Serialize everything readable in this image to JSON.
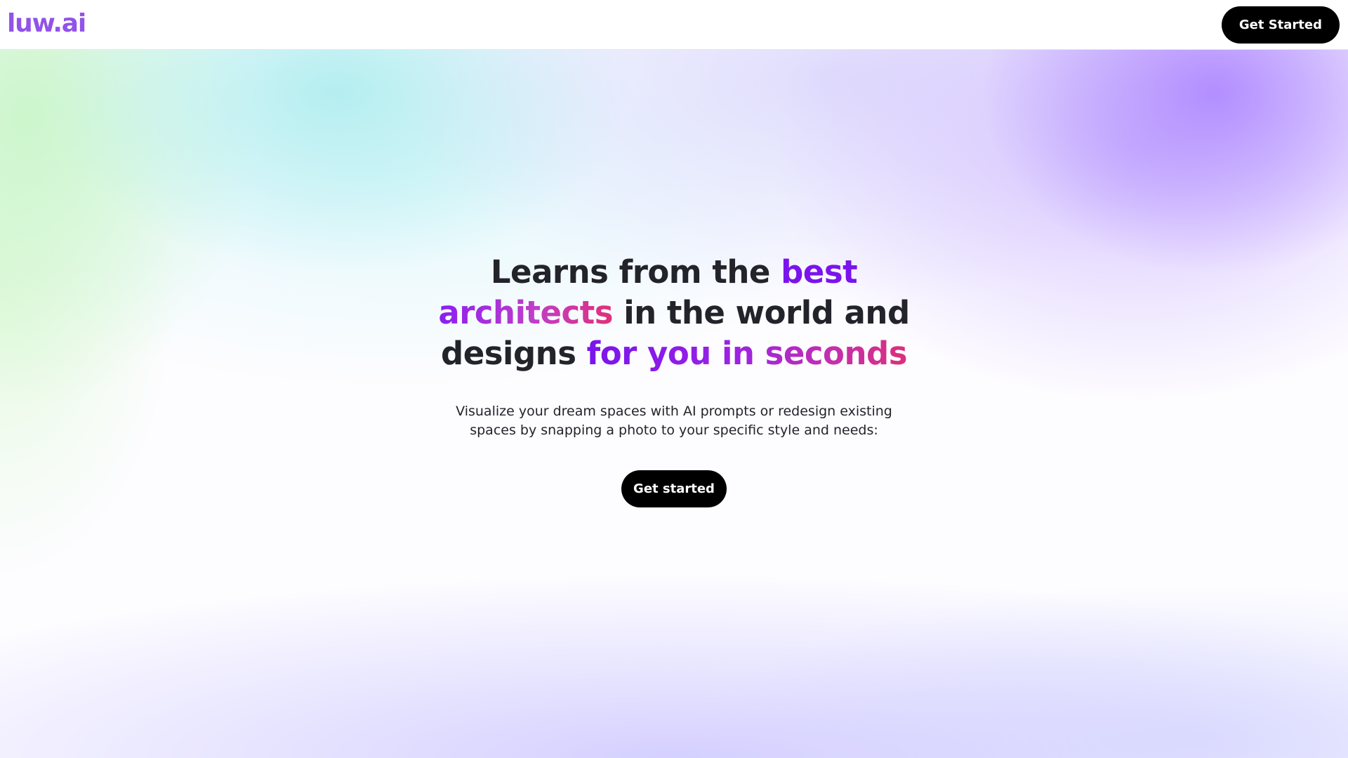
{
  "header": {
    "logo": "luw.ai",
    "cta_label": "Get Started"
  },
  "hero": {
    "headline": {
      "line1_plain": "Learns from the ",
      "line1_accent": "best",
      "line2_accent": "architects",
      "line2_plain": " in the world and",
      "line3_plain": "designs ",
      "line3_accent": "for you in seconds"
    },
    "subtitle": {
      "line1": "Visualize your dream spaces with AI prompts or redesign existing",
      "line2": "spaces by snapping a photo to your specific style and needs:"
    },
    "cta_label": "Get started"
  },
  "colors": {
    "brand": "#9253e8",
    "accent_purple": "#7a14ec",
    "accent_pink": "#dc2f7c",
    "text": "#23232b",
    "button_bg": "#000000",
    "button_text": "#ffffff"
  }
}
